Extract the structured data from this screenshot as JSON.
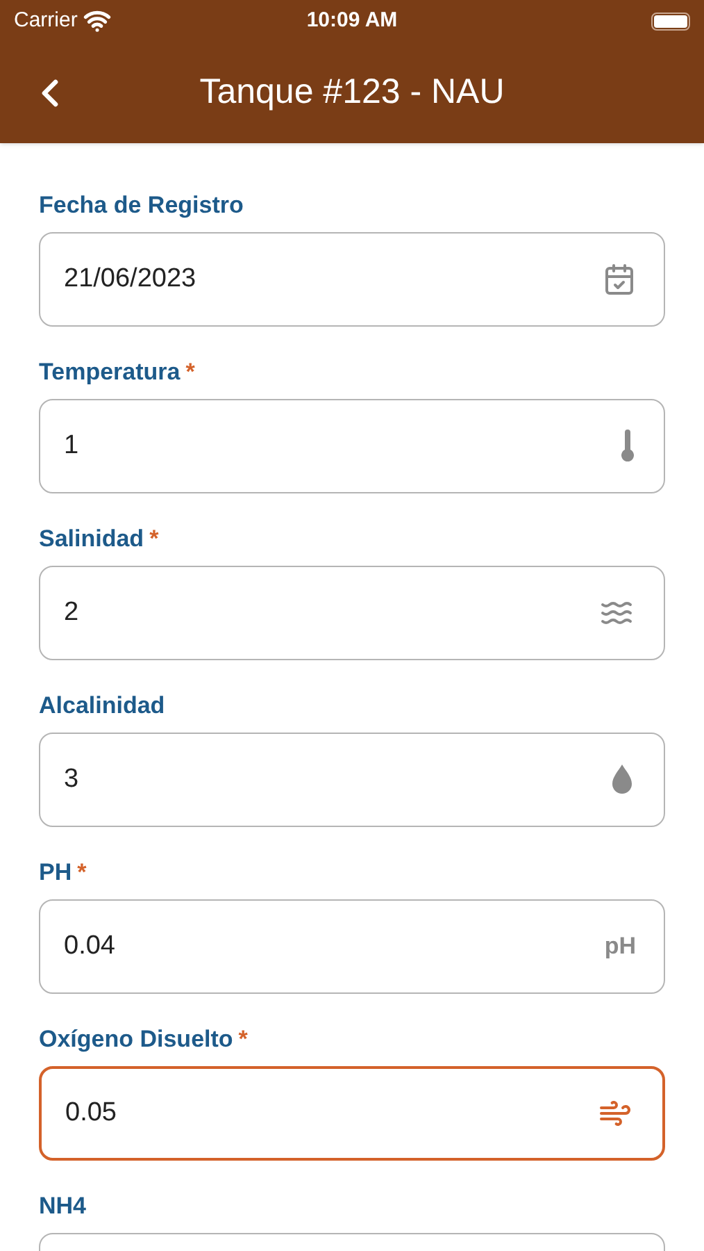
{
  "status_bar": {
    "carrier": "Carrier",
    "time": "10:09 AM"
  },
  "nav": {
    "title": "Tanque #123 - NAU"
  },
  "fields": [
    {
      "label": "Fecha de Registro",
      "required": false,
      "value": "21/06/2023",
      "kind": "calendar",
      "focused": false
    },
    {
      "label": "Temperatura",
      "required": true,
      "value": "1",
      "kind": "thermometer",
      "focused": false
    },
    {
      "label": "Salinidad",
      "required": true,
      "value": "2",
      "kind": "waves",
      "focused": false
    },
    {
      "label": "Alcalinidad",
      "required": false,
      "value": "3",
      "kind": "drop",
      "focused": false
    },
    {
      "label": "PH",
      "required": true,
      "value": "0.04",
      "kind": "text",
      "icon_text": "pH",
      "focused": false
    },
    {
      "label": "Oxígeno Disuelto",
      "required": true,
      "value": "0.05",
      "kind": "wind",
      "focused": true
    },
    {
      "label": "NH4",
      "required": false,
      "kind": "plain",
      "focused": false
    }
  ],
  "required_mark": "*"
}
